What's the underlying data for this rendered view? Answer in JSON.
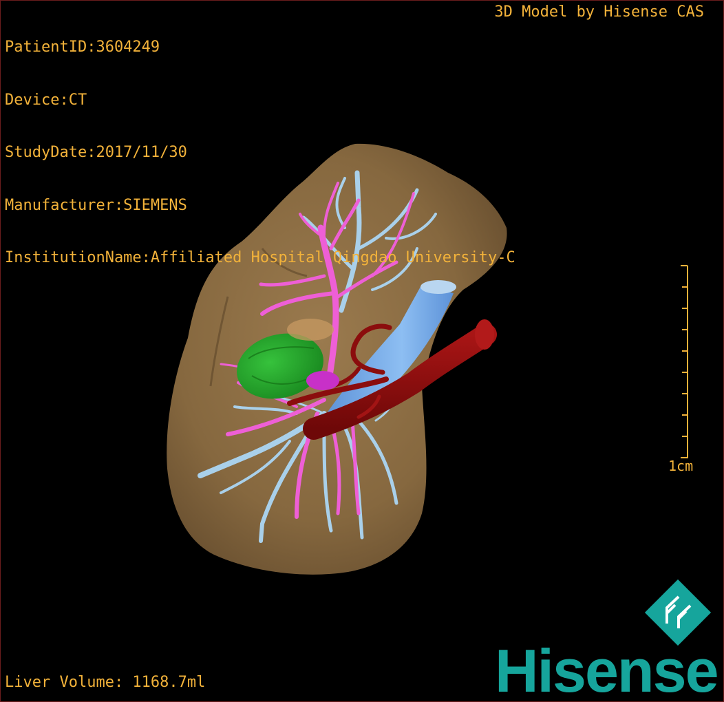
{
  "header": {
    "patient_id": "PatientID:3604249",
    "device": "Device:CT",
    "study_date": "StudyDate:2017/11/30",
    "manufacturer": "Manufacturer:SIEMENS",
    "institution": "InstitutionName:Affiliated Hospital Qingdao University-C"
  },
  "credit": "3D Model by Hisense CAS",
  "scale_bar": {
    "label": "1cm"
  },
  "liver_volume": "Liver Volume: 1168.7ml",
  "logo": {
    "text": "Hisense",
    "icon": "hisense-logo-icon",
    "color": "#16a59c"
  },
  "colors": {
    "overlay_text": "#f2b23a",
    "liver": "#8b6d44",
    "portal_vein": "#a8cfe8",
    "hepatic_vein": "#ee5fd6",
    "artery_aorta": "#8b0d0d",
    "tumor": "#23a52a",
    "ivc": "#6ea6e6"
  }
}
